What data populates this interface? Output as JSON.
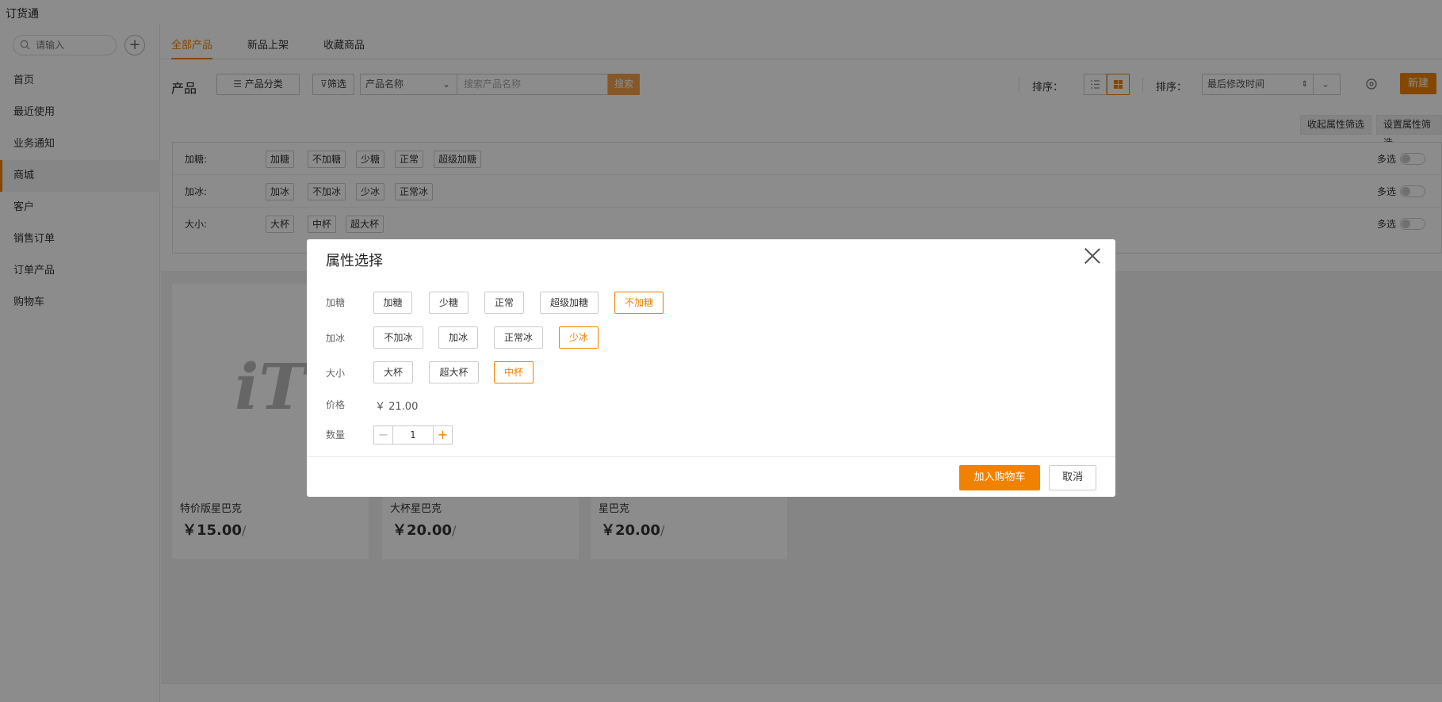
{
  "app": {
    "title": "订货通"
  },
  "sidebar": {
    "search_placeholder": "请输入",
    "items": [
      {
        "label": "首页"
      },
      {
        "label": "最近使用"
      },
      {
        "label": "业务通知"
      },
      {
        "label": "商城",
        "active": true
      },
      {
        "label": "客户"
      },
      {
        "label": "销售订单"
      },
      {
        "label": "订单产品"
      },
      {
        "label": "购物车"
      }
    ]
  },
  "tabs": [
    {
      "label": "全部产品",
      "active": true
    },
    {
      "label": "新品上架"
    },
    {
      "label": "收藏商品"
    }
  ],
  "toolbar": {
    "title": "产品",
    "category_btn": "产品分类",
    "filter_btn": "筛选",
    "field_select": "产品名称",
    "search_placeholder": "搜索产品名称",
    "search_btn": "搜索",
    "sort_label_1": "排序：",
    "sort_label_2": "排序：",
    "sort_select": "最后修改时间",
    "new_btn": "新建",
    "collapse_attr": "收起属性筛选",
    "set_attr": "设置属性筛选"
  },
  "filters": [
    {
      "label": "加糖:",
      "chips": [
        "加糖",
        "不加糖",
        "少糖",
        "正常",
        "超级加糖"
      ],
      "multi": "多选"
    },
    {
      "label": "加冰:",
      "chips": [
        "加冰",
        "不加冰",
        "少冰",
        "正常冰"
      ],
      "multi": "多选"
    },
    {
      "label": "大小:",
      "chips": [
        "大杯",
        "中杯",
        "超大杯"
      ],
      "multi": "多选"
    }
  ],
  "products": [
    {
      "logo": "iT",
      "name": "特价版星巴克",
      "price": "￥15.00",
      "unit": "/"
    },
    {
      "logo": "",
      "name": "大杯星巴克",
      "price": "￥20.00",
      "unit": "/"
    },
    {
      "logo": "",
      "name": "星巴克",
      "price": "￥20.00",
      "unit": "/"
    }
  ],
  "modal": {
    "title": "属性选择",
    "groups": [
      {
        "label": "加糖",
        "options": [
          "加糖",
          "少糖",
          "正常",
          "超级加糖",
          "不加糖"
        ],
        "selected": "不加糖"
      },
      {
        "label": "加冰",
        "options": [
          "不加冰",
          "加冰",
          "正常冰",
          "少冰"
        ],
        "selected": "少冰"
      },
      {
        "label": "大小",
        "options": [
          "大杯",
          "超大杯",
          "中杯"
        ],
        "selected": "中杯"
      }
    ],
    "price_label": "价格",
    "price_value": "￥  21.00",
    "qty_label": "数量",
    "qty_value": "1",
    "add_to_cart": "加入购物车",
    "cancel": "取消"
  },
  "colors": {
    "accent": "#f08200",
    "accent_light": "#f5a04a"
  }
}
